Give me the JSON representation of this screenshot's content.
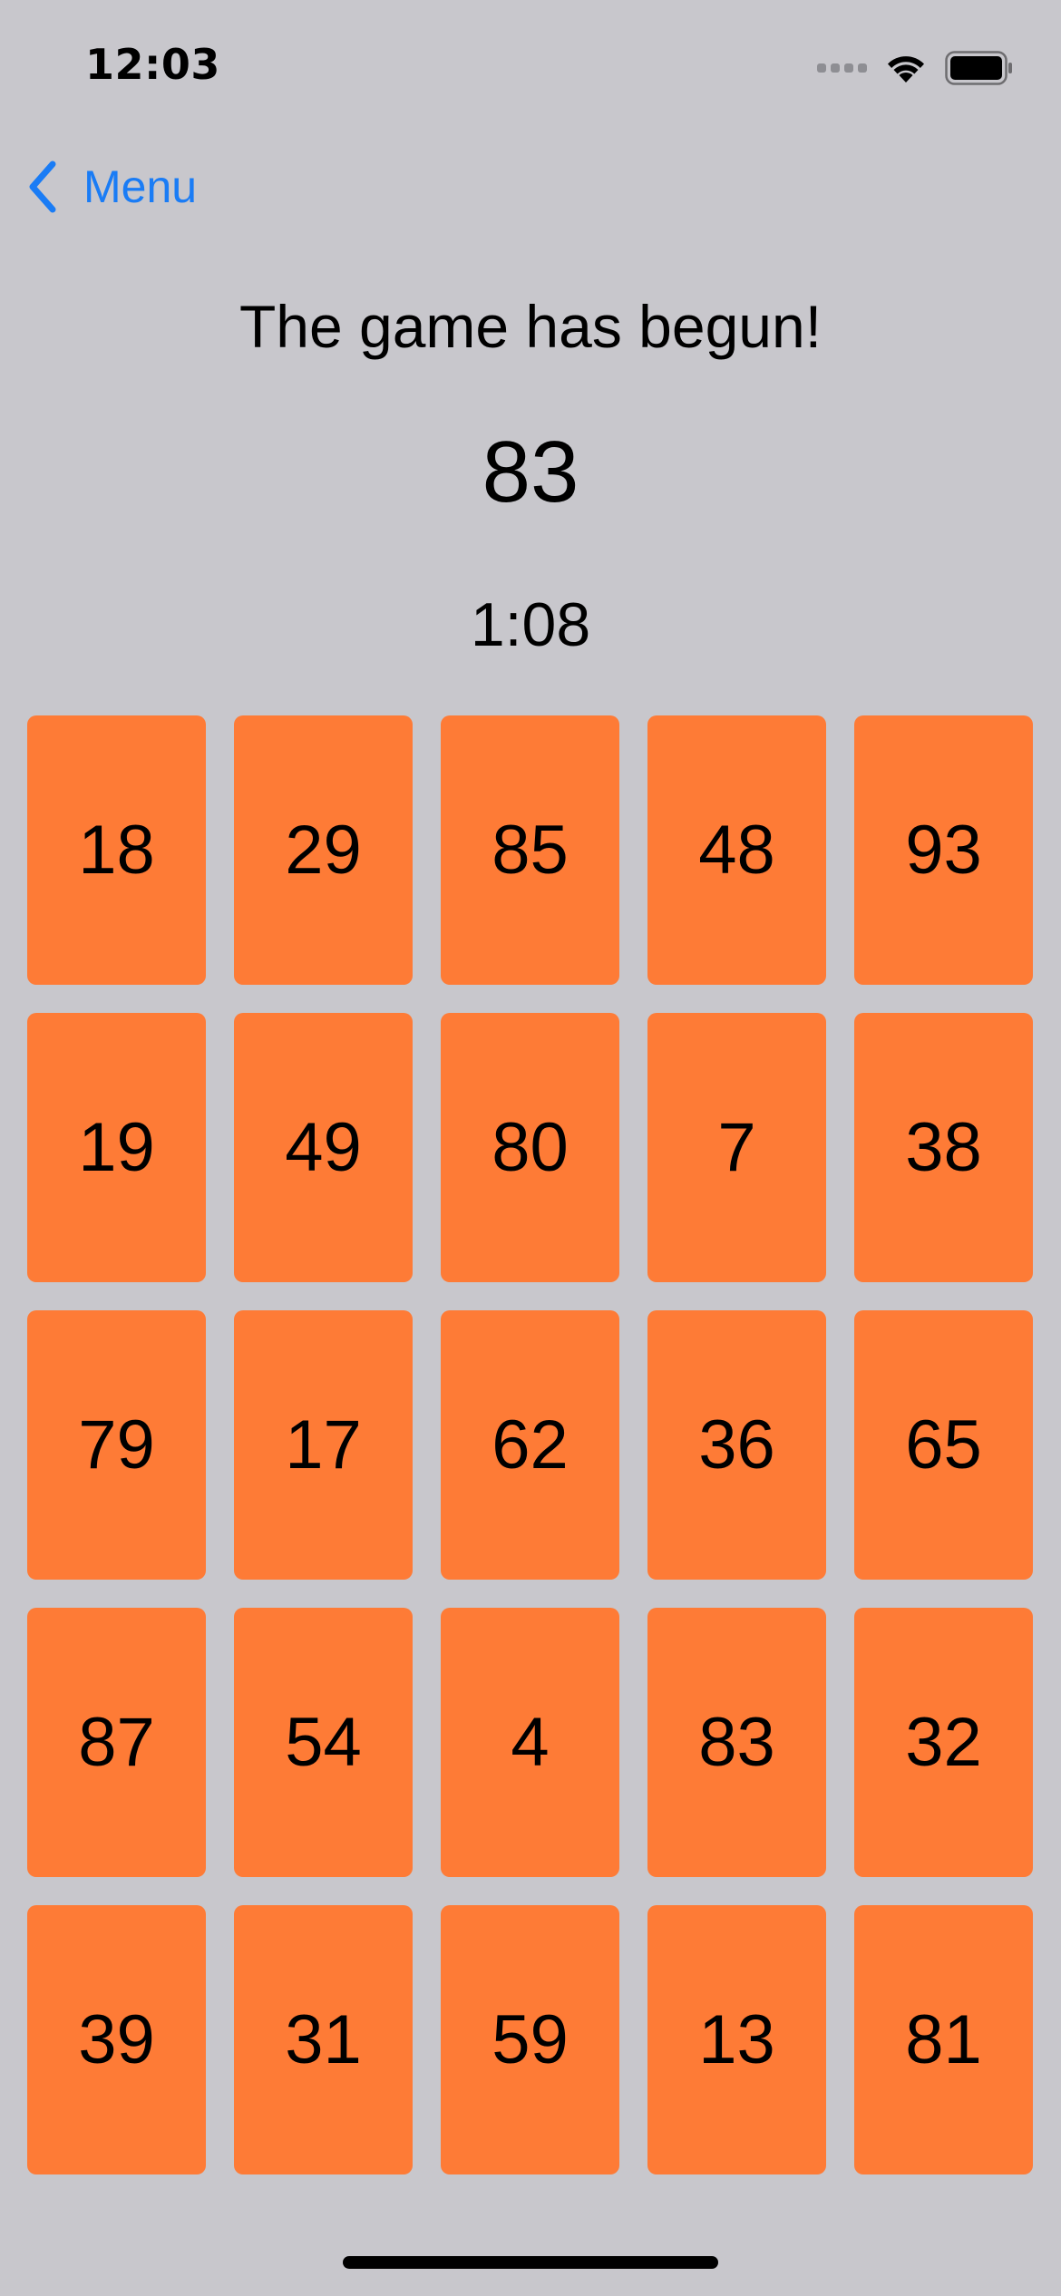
{
  "status_bar": {
    "time": "12:03"
  },
  "nav": {
    "back_label": "Menu"
  },
  "game": {
    "headline": "The game has begun!",
    "target_number": "83",
    "timer": "1:08"
  },
  "cards": [
    "18",
    "29",
    "85",
    "48",
    "93",
    "19",
    "49",
    "80",
    "7",
    "38",
    "79",
    "17",
    "62",
    "36",
    "65",
    "87",
    "54",
    "4",
    "83",
    "32",
    "39",
    "31",
    "59",
    "13",
    "81"
  ],
  "colors": {
    "background": "#c8c7cc",
    "card": "#fe7b36",
    "accent": "#1a7cf5"
  }
}
